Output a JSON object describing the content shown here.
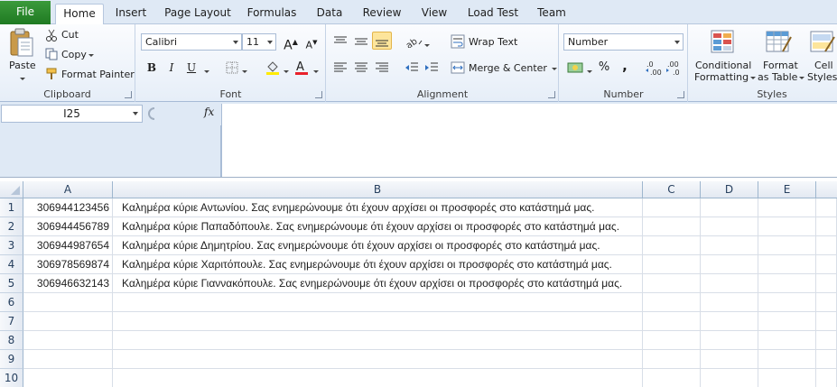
{
  "tabs": [
    "File",
    "Home",
    "Insert",
    "Page Layout",
    "Formulas",
    "Data",
    "Review",
    "View",
    "Load Test",
    "Team"
  ],
  "clipboard": {
    "paste": "Paste",
    "cut": "Cut",
    "copy": "Copy",
    "format_painter": "Format Painter",
    "label": "Clipboard"
  },
  "font": {
    "name": "Calibri",
    "size": "11",
    "bold": "B",
    "italic": "I",
    "underline": "U",
    "label": "Font"
  },
  "alignment": {
    "wrap_text": "Wrap Text",
    "merge_center": "Merge & Center",
    "label": "Alignment"
  },
  "number": {
    "format": "Number",
    "percent": "%",
    "comma": ",",
    "label": "Number"
  },
  "styles": {
    "conditional": "Conditional",
    "formatting": "Formatting",
    "format": "Format",
    "as_table": "as Table",
    "cell": "Cell",
    "cell_styles": "Styles",
    "label": "Styles"
  },
  "formula_bar": {
    "name_box": "I25",
    "fx": "fx",
    "value": ""
  },
  "columns": [
    "A",
    "B",
    "C",
    "D",
    "E"
  ],
  "rows": [
    {
      "num": "1",
      "a": "306944123456",
      "b": "Καλημέρα κύριε Αντωνίου. Σας ενημερώνουμε ότι έχουν αρχίσει οι προσφορές στο κατάστημά μας."
    },
    {
      "num": "2",
      "a": "306944456789",
      "b": "Καλημέρα κύριε Παπαδόπουλε. Σας ενημερώνουμε ότι έχουν αρχίσει οι προσφορές στο κατάστημά μας."
    },
    {
      "num": "3",
      "a": "306944987654",
      "b": "Καλημέρα κύριε Δημητρίου. Σας ενημερώνουμε ότι έχουν αρχίσει οι προσφορές στο κατάστημά μας."
    },
    {
      "num": "4",
      "a": "306978569874",
      "b": "Καλημέρα κύριε Χαριτόπουλε. Σας ενημερώνουμε ότι έχουν αρχίσει οι προσφορές στο κατάστημά μας."
    },
    {
      "num": "5",
      "a": "306946632143",
      "b": "Καλημέρα κύριε Γιαννακόπουλε. Σας ενημερώνουμε ότι έχουν αρχίσει οι προσφορές στο κατάστημά μας."
    },
    {
      "num": "6",
      "a": "",
      "b": ""
    },
    {
      "num": "7",
      "a": "",
      "b": ""
    },
    {
      "num": "8",
      "a": "",
      "b": ""
    },
    {
      "num": "9",
      "a": "",
      "b": ""
    },
    {
      "num": "10",
      "a": "",
      "b": ""
    }
  ]
}
